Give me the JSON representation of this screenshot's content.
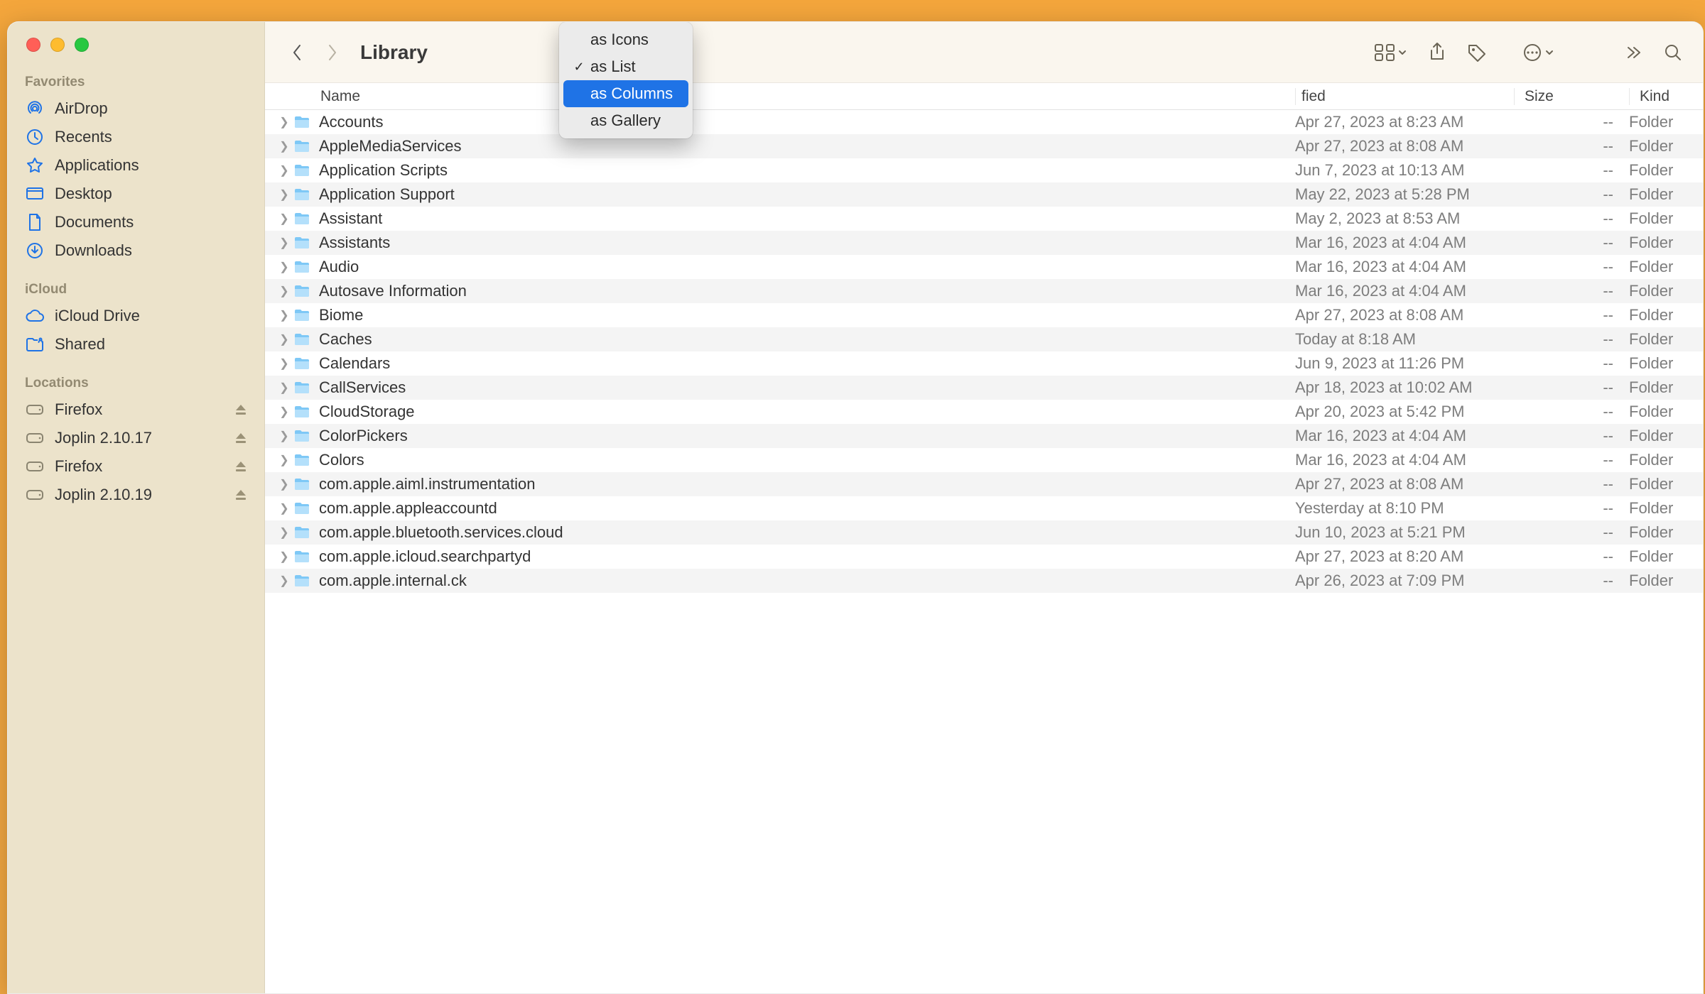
{
  "window_title": "Library",
  "sidebar": {
    "sections": [
      {
        "header": "Favorites",
        "items": [
          {
            "icon": "airdrop",
            "label": "AirDrop"
          },
          {
            "icon": "recents",
            "label": "Recents"
          },
          {
            "icon": "apps",
            "label": "Applications"
          },
          {
            "icon": "desktop",
            "label": "Desktop"
          },
          {
            "icon": "documents",
            "label": "Documents"
          },
          {
            "icon": "downloads",
            "label": "Downloads"
          }
        ]
      },
      {
        "header": "iCloud",
        "items": [
          {
            "icon": "icloud",
            "label": "iCloud Drive"
          },
          {
            "icon": "shared",
            "label": "Shared"
          }
        ]
      },
      {
        "header": "Locations",
        "items": [
          {
            "icon": "disk",
            "label": "Firefox",
            "eject": true
          },
          {
            "icon": "disk",
            "label": "Joplin 2.10.17",
            "eject": true
          },
          {
            "icon": "disk",
            "label": "Firefox",
            "eject": true
          },
          {
            "icon": "disk",
            "label": "Joplin 2.10.19",
            "eject": true
          }
        ]
      }
    ]
  },
  "columns": {
    "name": "Name",
    "modified_suffix": "fied",
    "size": "Size",
    "kind": "Kind"
  },
  "view_menu": {
    "items": [
      {
        "label": "as Icons",
        "checked": false,
        "highlight": false
      },
      {
        "label": "as List",
        "checked": true,
        "highlight": false
      },
      {
        "label": "as Columns",
        "checked": false,
        "highlight": true
      },
      {
        "label": "as Gallery",
        "checked": false,
        "highlight": false
      }
    ]
  },
  "files": [
    {
      "name": "Accounts",
      "modified": "Apr 27, 2023 at 8:23 AM",
      "size": "--",
      "kind": "Folder"
    },
    {
      "name": "AppleMediaServices",
      "modified": "Apr 27, 2023 at 8:08 AM",
      "size": "--",
      "kind": "Folder"
    },
    {
      "name": "Application Scripts",
      "modified": "Jun 7, 2023 at 10:13 AM",
      "size": "--",
      "kind": "Folder"
    },
    {
      "name": "Application Support",
      "modified": "May 22, 2023 at 5:28 PM",
      "size": "--",
      "kind": "Folder"
    },
    {
      "name": "Assistant",
      "modified": "May 2, 2023 at 8:53 AM",
      "size": "--",
      "kind": "Folder"
    },
    {
      "name": "Assistants",
      "modified": "Mar 16, 2023 at 4:04 AM",
      "size": "--",
      "kind": "Folder"
    },
    {
      "name": "Audio",
      "modified": "Mar 16, 2023 at 4:04 AM",
      "size": "--",
      "kind": "Folder"
    },
    {
      "name": "Autosave Information",
      "modified": "Mar 16, 2023 at 4:04 AM",
      "size": "--",
      "kind": "Folder"
    },
    {
      "name": "Biome",
      "modified": "Apr 27, 2023 at 8:08 AM",
      "size": "--",
      "kind": "Folder"
    },
    {
      "name": "Caches",
      "modified": "Today at 8:18 AM",
      "size": "--",
      "kind": "Folder"
    },
    {
      "name": "Calendars",
      "modified": "Jun 9, 2023 at 11:26 PM",
      "size": "--",
      "kind": "Folder"
    },
    {
      "name": "CallServices",
      "modified": "Apr 18, 2023 at 10:02 AM",
      "size": "--",
      "kind": "Folder"
    },
    {
      "name": "CloudStorage",
      "modified": "Apr 20, 2023 at 5:42 PM",
      "size": "--",
      "kind": "Folder"
    },
    {
      "name": "ColorPickers",
      "modified": "Mar 16, 2023 at 4:04 AM",
      "size": "--",
      "kind": "Folder"
    },
    {
      "name": "Colors",
      "modified": "Mar 16, 2023 at 4:04 AM",
      "size": "--",
      "kind": "Folder"
    },
    {
      "name": "com.apple.aiml.instrumentation",
      "modified": "Apr 27, 2023 at 8:08 AM",
      "size": "--",
      "kind": "Folder"
    },
    {
      "name": "com.apple.appleaccountd",
      "modified": "Yesterday at 8:10 PM",
      "size": "--",
      "kind": "Folder"
    },
    {
      "name": "com.apple.bluetooth.services.cloud",
      "modified": "Jun 10, 2023 at 5:21 PM",
      "size": "--",
      "kind": "Folder"
    },
    {
      "name": "com.apple.icloud.searchpartyd",
      "modified": "Apr 27, 2023 at 8:20 AM",
      "size": "--",
      "kind": "Folder"
    },
    {
      "name": "com.apple.internal.ck",
      "modified": "Apr 26, 2023 at 7:09 PM",
      "size": "--",
      "kind": "Folder"
    }
  ]
}
